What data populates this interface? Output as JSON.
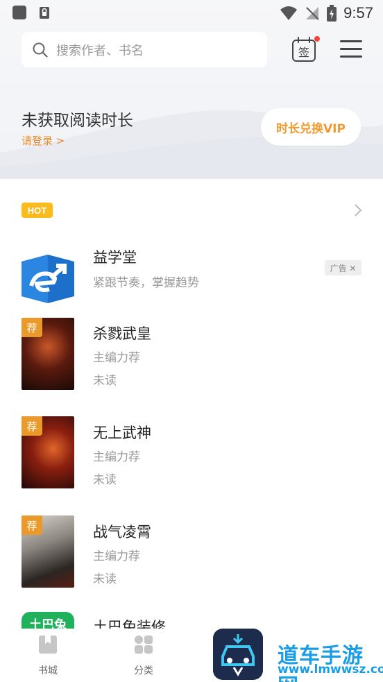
{
  "status_bar": {
    "time": "9:57"
  },
  "search": {
    "placeholder": "搜索作者、书名"
  },
  "sign": {
    "label": "签"
  },
  "reading": {
    "title": "未获取阅读时长",
    "login": "请登录 >",
    "vip_button": "时长兑换VIP"
  },
  "section": {
    "badge": "HOT"
  },
  "ad": {
    "title": "益学堂",
    "subtitle": "紧跟节奏，掌握趋势",
    "tag": "广告 ✕"
  },
  "books": [
    {
      "title": "杀戮武皇",
      "tag": "荐",
      "recommend": "主编力荐",
      "status": "未读"
    },
    {
      "title": "无上武神",
      "tag": "荐",
      "recommend": "主编力荐",
      "status": "未读"
    },
    {
      "title": "战气凌霄",
      "tag": "荐",
      "recommend": "主编力荐",
      "status": "未读"
    },
    {
      "title": "土巴兔装修",
      "badge": "土巴兔"
    }
  ],
  "tabs": [
    {
      "label": "书城",
      "icon": "bookmark-icon"
    },
    {
      "label": "分类",
      "icon": "grid-icon"
    }
  ],
  "watermark": {
    "title": "道车手游网",
    "url": "www.lmwwsz.com"
  },
  "colors": {
    "accent": "#e99a2a",
    "hot": "#fbbb1d",
    "vip_text": "#f19a2e",
    "watermark": "#1a9de6"
  }
}
